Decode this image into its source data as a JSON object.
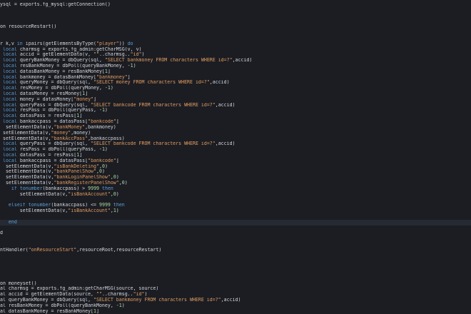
{
  "editor": {
    "colors": {
      "background": "#1b1d23",
      "text": "#d4d7dd",
      "keyword": "#5c9fd6",
      "string": "#e39b5f",
      "number": "#aedba0",
      "active_line": "#262a32"
    },
    "active_line_index": 39,
    "lines": [
      [
        [
          "p",
          "ysql = exports.fg_mysql:getConnection()"
        ]
      ],
      [],
      [],
      [],
      [
        [
          "p",
          "on resourceRestart()"
        ]
      ],
      [],
      [],
      [
        [
          "p",
          "r k,v "
        ],
        [
          "k",
          "in"
        ],
        [
          "p",
          " ipairs(getElementsByType("
        ],
        [
          "s",
          "\"player\""
        ],
        [
          "p",
          ")) "
        ],
        [
          "k",
          "do"
        ]
      ],
      [
        [
          "p",
          " "
        ],
        [
          "k",
          "local"
        ],
        [
          "p",
          " charmsg = exports.fg_admin:getCharMSG(v, v)"
        ]
      ],
      [
        [
          "p",
          " "
        ],
        [
          "k",
          "local"
        ],
        [
          "p",
          " accid = getElementData(v, "
        ],
        [
          "s",
          "\"\""
        ],
        [
          "p",
          "..charmsg.."
        ],
        [
          "s",
          "\"id\""
        ],
        [
          "p",
          ")"
        ]
      ],
      [
        [
          "p",
          " "
        ],
        [
          "k",
          "local"
        ],
        [
          "p",
          " queryBankMoney = dbQuery(sql, "
        ],
        [
          "s",
          "\"SELECT bankmoney FROM characters WHERE id=?\""
        ],
        [
          "p",
          ",accid)"
        ]
      ],
      [
        [
          "p",
          " "
        ],
        [
          "k",
          "local"
        ],
        [
          "p",
          " resBankMoney = dbPoll(queryBankMoney, -"
        ],
        [
          "n",
          "1"
        ],
        [
          "p",
          ")"
        ]
      ],
      [
        [
          "p",
          " "
        ],
        [
          "k",
          "local"
        ],
        [
          "p",
          " datasBankMoney = resBankMoney["
        ],
        [
          "n",
          "1"
        ],
        [
          "p",
          "]"
        ]
      ],
      [
        [
          "p",
          " "
        ],
        [
          "k",
          "local"
        ],
        [
          "p",
          " bankmoney = datasBankMoney["
        ],
        [
          "s",
          "\"bankmoney\""
        ],
        [
          "p",
          "]"
        ]
      ],
      [
        [
          "p",
          " "
        ],
        [
          "k",
          "local"
        ],
        [
          "p",
          " queryMoney = dbQuery(sql, "
        ],
        [
          "s",
          "\"SELECT money FROM characters WHERE id=?\""
        ],
        [
          "p",
          ",accid)"
        ]
      ],
      [
        [
          "p",
          " "
        ],
        [
          "k",
          "local"
        ],
        [
          "p",
          " resMoney = dbPoll(queryMoney, -"
        ],
        [
          "n",
          "1"
        ],
        [
          "p",
          ")"
        ]
      ],
      [
        [
          "p",
          " "
        ],
        [
          "k",
          "local"
        ],
        [
          "p",
          " datasMoney = resMoney["
        ],
        [
          "n",
          "1"
        ],
        [
          "p",
          "]"
        ]
      ],
      [
        [
          "p",
          " "
        ],
        [
          "k",
          "local"
        ],
        [
          "p",
          " money = datasMoney["
        ],
        [
          "s",
          "\"money\""
        ],
        [
          "p",
          "]"
        ]
      ],
      [
        [
          "p",
          " "
        ],
        [
          "k",
          "local"
        ],
        [
          "p",
          " queryPass = dbQuery(sql, "
        ],
        [
          "s",
          "\"SELECT bankcode FROM characters WHERE id=?\""
        ],
        [
          "p",
          ",accid)"
        ]
      ],
      [
        [
          "p",
          " "
        ],
        [
          "k",
          "local"
        ],
        [
          "p",
          " resPass = dbPoll(queryPass, -"
        ],
        [
          "n",
          "1"
        ],
        [
          "p",
          ")"
        ]
      ],
      [
        [
          "p",
          " "
        ],
        [
          "k",
          "local"
        ],
        [
          "p",
          " datasPass = resPass["
        ],
        [
          "n",
          "1"
        ],
        [
          "p",
          "]"
        ]
      ],
      [
        [
          "p",
          " "
        ],
        [
          "k",
          "local"
        ],
        [
          "p",
          " bankaccpass = datasPass["
        ],
        [
          "s",
          "\"bankcode\""
        ],
        [
          "p",
          "]"
        ]
      ],
      [
        [
          "p",
          "  setElementData(v,"
        ],
        [
          "s",
          "\"bankMoney\""
        ],
        [
          "p",
          ",bankmoney)"
        ]
      ],
      [
        [
          "p",
          " setElementData(v,"
        ],
        [
          "s",
          "\"money\""
        ],
        [
          "p",
          ",money)"
        ]
      ],
      [
        [
          "p",
          " setElementData(v,"
        ],
        [
          "s",
          "\"bankAccPass\""
        ],
        [
          "p",
          ",bankaccpass)"
        ]
      ],
      [
        [
          "p",
          " "
        ],
        [
          "k",
          "local"
        ],
        [
          "p",
          " queryPass = dbQuery(sql, "
        ],
        [
          "s",
          "\"SELECT bankcode FROM characters WHERE id=?\""
        ],
        [
          "p",
          ",accid)"
        ]
      ],
      [
        [
          "p",
          " "
        ],
        [
          "k",
          "local"
        ],
        [
          "p",
          " resPass = dbPoll(queryPass, -"
        ],
        [
          "n",
          "1"
        ],
        [
          "p",
          ")"
        ]
      ],
      [
        [
          "p",
          " "
        ],
        [
          "k",
          "local"
        ],
        [
          "p",
          " datasPass = resPass["
        ],
        [
          "n",
          "1"
        ],
        [
          "p",
          "]"
        ]
      ],
      [
        [
          "p",
          " "
        ],
        [
          "k",
          "local"
        ],
        [
          "p",
          " bankaccpass = datasPass["
        ],
        [
          "s",
          "\"bankcode\""
        ],
        [
          "p",
          "]"
        ]
      ],
      [
        [
          "p",
          "  setElementData(v,"
        ],
        [
          "s",
          "\"isBankDeleting\""
        ],
        [
          "p",
          ","
        ],
        [
          "n",
          "0"
        ],
        [
          "p",
          ")"
        ]
      ],
      [
        [
          "p",
          "  setElementData(v,"
        ],
        [
          "s",
          "\"bankPanelShow\""
        ],
        [
          "p",
          ","
        ],
        [
          "n",
          "0"
        ],
        [
          "p",
          ")"
        ]
      ],
      [
        [
          "p",
          "  setElementData(v,"
        ],
        [
          "s",
          "\"bankLoginPanelShow\""
        ],
        [
          "p",
          ","
        ],
        [
          "n",
          "0"
        ],
        [
          "p",
          ")"
        ]
      ],
      [
        [
          "p",
          "  setElementData(v,"
        ],
        [
          "s",
          "\"bankRegisterPanelShow\""
        ],
        [
          "p",
          ","
        ],
        [
          "n",
          "0"
        ],
        [
          "p",
          ")"
        ]
      ],
      [
        [
          "p",
          "    "
        ],
        [
          "k",
          "if"
        ],
        [
          "p",
          " "
        ],
        [
          "k",
          "tonumber"
        ],
        [
          "p",
          "(bankaccpass) > "
        ],
        [
          "n",
          "9999"
        ],
        [
          "p",
          " "
        ],
        [
          "k",
          "then"
        ]
      ],
      [
        [
          "p",
          "       setElementData(v,"
        ],
        [
          "s",
          "\"isBankAccount\""
        ],
        [
          "p",
          ","
        ],
        [
          "n",
          "0"
        ],
        [
          "p",
          ")"
        ]
      ],
      [],
      [
        [
          "p",
          "   "
        ],
        [
          "k",
          "elseif"
        ],
        [
          "p",
          " "
        ],
        [
          "k",
          "tonumber"
        ],
        [
          "p",
          "(bankaccpass) <= "
        ],
        [
          "n",
          "9999"
        ],
        [
          "p",
          " "
        ],
        [
          "k",
          "then"
        ]
      ],
      [
        [
          "p",
          "       setElementData(v,"
        ],
        [
          "s",
          "\"isBankAccount\""
        ],
        [
          "p",
          ","
        ],
        [
          "n",
          "1"
        ],
        [
          "p",
          ")"
        ]
      ],
      [],
      [
        [
          "p",
          "   "
        ],
        [
          "k",
          "end"
        ]
      ],
      [],
      [
        [
          "p",
          "d"
        ]
      ],
      [],
      [],
      [
        [
          "p",
          "ntHandler("
        ],
        [
          "s",
          "\"onResourceStart\""
        ],
        [
          "p",
          ",resourceRoot,resourceRestart)"
        ]
      ],
      [],
      [],
      [],
      [],
      [],
      [
        [
          "p",
          "on moneyset()"
        ]
      ],
      [
        [
          "p",
          "al charmsg = exports.fg_admin:getCharMSG(source, source)"
        ]
      ],
      [
        [
          "p",
          "al accid = getElementData(source, "
        ],
        [
          "s",
          "\"\""
        ],
        [
          "p",
          "..charmsg.."
        ],
        [
          "s",
          "\"id\""
        ],
        [
          "p",
          ")"
        ]
      ],
      [
        [
          "p",
          "al queryBankMoney = dbQuery(sql, "
        ],
        [
          "s",
          "\"SELECT bankmoney FROM characters WHERE id=?\""
        ],
        [
          "p",
          ",accid)"
        ]
      ],
      [
        [
          "p",
          "al resBankMoney = dbPoll(queryBankMoney, -"
        ],
        [
          "n",
          "1"
        ],
        [
          "p",
          ")"
        ]
      ],
      [
        [
          "p",
          "al datasBankMoney = resBankMoney["
        ],
        [
          "n",
          "1"
        ],
        [
          "p",
          "]"
        ]
      ]
    ]
  }
}
